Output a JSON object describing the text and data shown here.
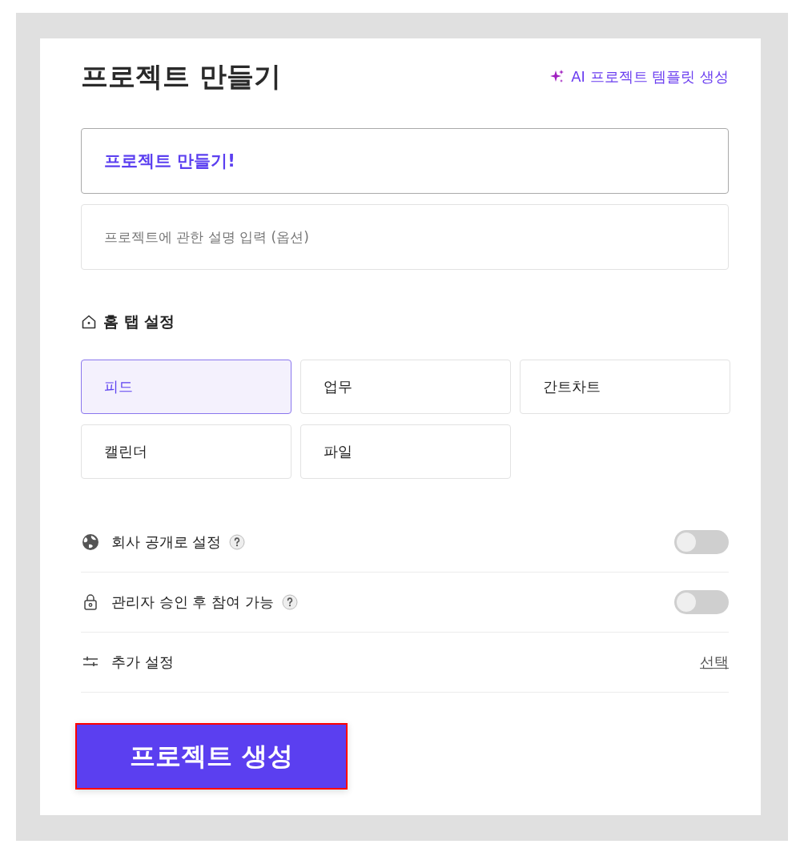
{
  "title": "프로젝트 만들기",
  "ai_link": {
    "label": "AI 프로젝트 템플릿 생성"
  },
  "name_field": {
    "value": "프로젝트 만들기!"
  },
  "description_field": {
    "placeholder": "프로젝트에 관한 설명 입력 (옵션)"
  },
  "home_tab": {
    "heading": "홈 탭 설정",
    "options": [
      {
        "label": "피드",
        "selected": true
      },
      {
        "label": "업무",
        "selected": false
      },
      {
        "label": "간트차트",
        "selected": false
      },
      {
        "label": "캘린더",
        "selected": false
      },
      {
        "label": "파일",
        "selected": false
      }
    ]
  },
  "settings": [
    {
      "kind": "toggle",
      "label": "회사 공개로 설정",
      "help": true,
      "on": false
    },
    {
      "kind": "toggle",
      "label": "관리자 승인 후 참여 가능",
      "help": true,
      "on": false
    },
    {
      "kind": "link",
      "label": "추가 설정",
      "action": "선택"
    }
  ],
  "submit_button": {
    "label": "프로젝트 생성"
  }
}
